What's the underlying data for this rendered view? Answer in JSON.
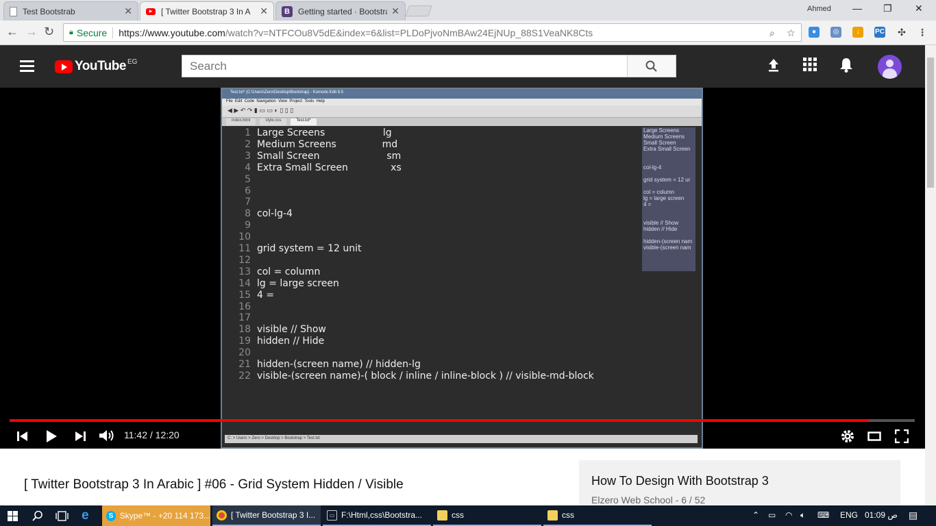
{
  "browser": {
    "tabs": [
      {
        "title": "Test Bootstrab",
        "icon": "document-icon"
      },
      {
        "title": "[ Twitter Bootstrap 3 In A",
        "icon": "youtube-icon"
      },
      {
        "title": "Getting started · Bootstra",
        "icon": "bootstrap-icon"
      }
    ],
    "profile_name": "Ahmed",
    "secure_label": "Secure",
    "url_host": "https://www.youtube.com",
    "url_path": "/watch?v=NTFCOu8V5dE&index=6&list=PLDoPjvoNmBAw24EjNUp_88S1VeaNK8Cts"
  },
  "youtube": {
    "logo_text": "YouTube",
    "country_code": "EG",
    "search_placeholder": "Search"
  },
  "editor": {
    "title": "Test.txt* (C:\\Users\\Zero\\Desktop\\Bootstrap) - Komodo Edit 8.5",
    "menu": [
      "File",
      "Edit",
      "Code",
      "Navigation",
      "View",
      "Project",
      "Tools",
      "Help"
    ],
    "tabs": [
      "index.html",
      "style.css",
      "Test.txt*"
    ],
    "status": "C: > Users > Zero > Desktop > Bootstrap > Test.txt",
    "lines": [
      {
        "n": "1",
        "text": "Large Screens                   lg"
      },
      {
        "n": "2",
        "text": "Medium Screens               md"
      },
      {
        "n": "3",
        "text": "Small Screen                      sm"
      },
      {
        "n": "4",
        "text": "Extra Small Screen              xs"
      },
      {
        "n": "5",
        "text": ""
      },
      {
        "n": "6",
        "text": ""
      },
      {
        "n": "7",
        "text": ""
      },
      {
        "n": "8",
        "text": "col-lg-4"
      },
      {
        "n": "9",
        "text": ""
      },
      {
        "n": "10",
        "text": ""
      },
      {
        "n": "11",
        "text": "grid system = 12 unit"
      },
      {
        "n": "12",
        "text": ""
      },
      {
        "n": "13",
        "text": "col = column"
      },
      {
        "n": "14",
        "text": "lg = large screen"
      },
      {
        "n": "15",
        "text": "4 ="
      },
      {
        "n": "16",
        "text": ""
      },
      {
        "n": "17",
        "text": ""
      },
      {
        "n": "18",
        "text": "visible // Show"
      },
      {
        "n": "19",
        "text": "hidden // Hide"
      },
      {
        "n": "20",
        "text": ""
      },
      {
        "n": "21",
        "text": "hidden-(screen name) // hidden-lg"
      },
      {
        "n": "22",
        "text": "visible-(screen name)-( block / inline / inline-block ) // visible-md-block"
      }
    ],
    "minimap": [
      "Large Screens",
      "Medium Screens",
      "Small Screen",
      "Extra Small Screen",
      "",
      "",
      "col-lg-4",
      "",
      "grid system = 12 ur",
      "",
      "col = column",
      "lg = large screen",
      "4 =",
      "",
      "",
      "visible // Show",
      "hidden // Hide",
      "",
      "hidden-(screen nam",
      "visible-(screen nam"
    ]
  },
  "player": {
    "current_time": "11:42",
    "duration": "12:20",
    "time_display": "11:42 / 12:20",
    "progress_fraction": 0.949
  },
  "video": {
    "title": "[ Twitter Bootstrap 3 In Arabic ] #06 - Grid System Hidden / Visible"
  },
  "playlist": {
    "title": "How To Design With Bootstrap 3",
    "subtitle": "Elzero Web School - 6 / 52"
  },
  "taskbar": {
    "items": [
      {
        "label": "Skype™ - +20 114 173...",
        "icon": "skype-icon"
      },
      {
        "label": "[ Twitter Bootstrap 3 I...",
        "icon": "chrome-icon"
      },
      {
        "label": "F:\\Html,css\\Bootstra...",
        "icon": "editor-icon"
      },
      {
        "label": "css",
        "icon": "folder-icon"
      },
      {
        "label": "css",
        "icon": "folder-icon"
      }
    ],
    "language": "ENG",
    "clock": "01:09 ص"
  },
  "colors": {
    "youtube_red": "#ff0000",
    "header_dark": "#282828",
    "taskbar": "#0f1a2a"
  }
}
